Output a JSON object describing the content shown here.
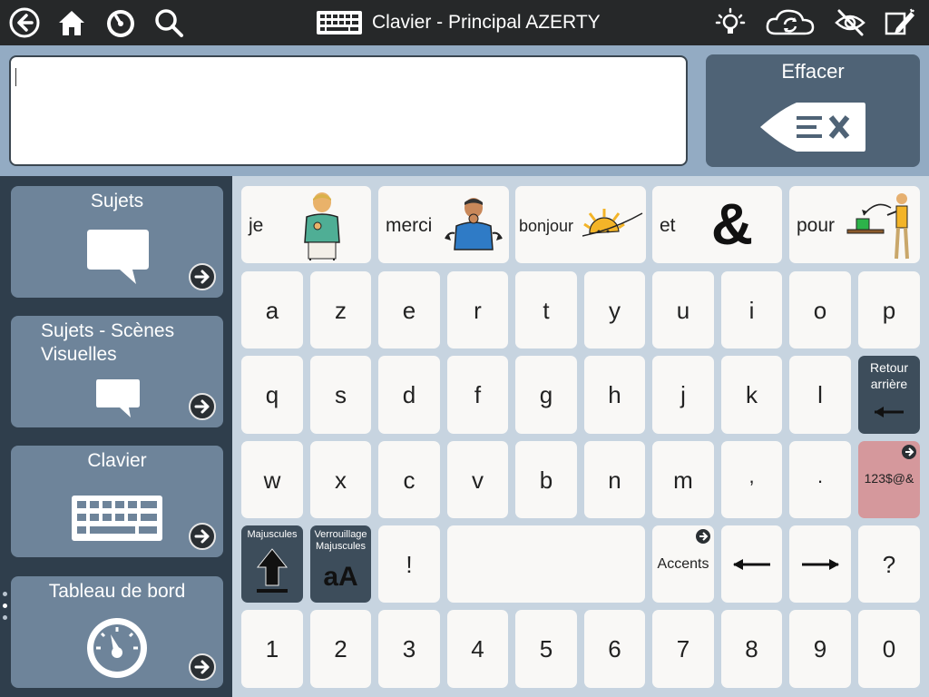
{
  "topbar": {
    "title": "Clavier - Principal AZERTY",
    "icons": [
      "back-icon",
      "home-icon",
      "dashboard-icon",
      "search-icon",
      "keyboard-icon",
      "brightness-icon",
      "sync-icon",
      "hide-icon",
      "edit-icon"
    ]
  },
  "message": {
    "value": ""
  },
  "clear": {
    "label": "Effacer",
    "icon": "backspace-clear-icon"
  },
  "sidebar": {
    "items": [
      {
        "label": "Sujets",
        "icon": "speech-bubble-icon"
      },
      {
        "label": "Sujets - Scènes Visuelles",
        "icon": "speech-bubble-icon"
      },
      {
        "label": "Clavier",
        "icon": "keyboard-icon"
      },
      {
        "label": "Tableau de bord",
        "icon": "dashboard-icon"
      }
    ]
  },
  "words": [
    {
      "label": "je",
      "icon": "person-pointing-self-icon"
    },
    {
      "label": "merci",
      "icon": "person-thanking-icon"
    },
    {
      "label": "bonjour",
      "icon": "sunrise-icon"
    },
    {
      "label": "et",
      "icon": "ampersand-icon"
    },
    {
      "label": "pour",
      "icon": "person-giving-icon"
    }
  ],
  "row1": [
    "a",
    "z",
    "e",
    "r",
    "t",
    "y",
    "u",
    "i",
    "o",
    "p"
  ],
  "row2": [
    "q",
    "s",
    "d",
    "f",
    "g",
    "h",
    "j",
    "k",
    "l"
  ],
  "backspace": {
    "label": "Retour arrière"
  },
  "row3": [
    "w",
    "x",
    "c",
    "v",
    "b",
    "n",
    "m",
    ",",
    "."
  ],
  "symbols": {
    "label": "123$@&"
  },
  "row4": {
    "shift": "Majuscules",
    "capslock": "Verrouillage Majuscules",
    "capslock_glyph": "aA",
    "exclaim": "!",
    "accents": "Accents",
    "question": "?"
  },
  "digits": [
    "1",
    "2",
    "3",
    "4",
    "5",
    "6",
    "7",
    "8",
    "9",
    "0"
  ],
  "symbol_ampersand": "&"
}
